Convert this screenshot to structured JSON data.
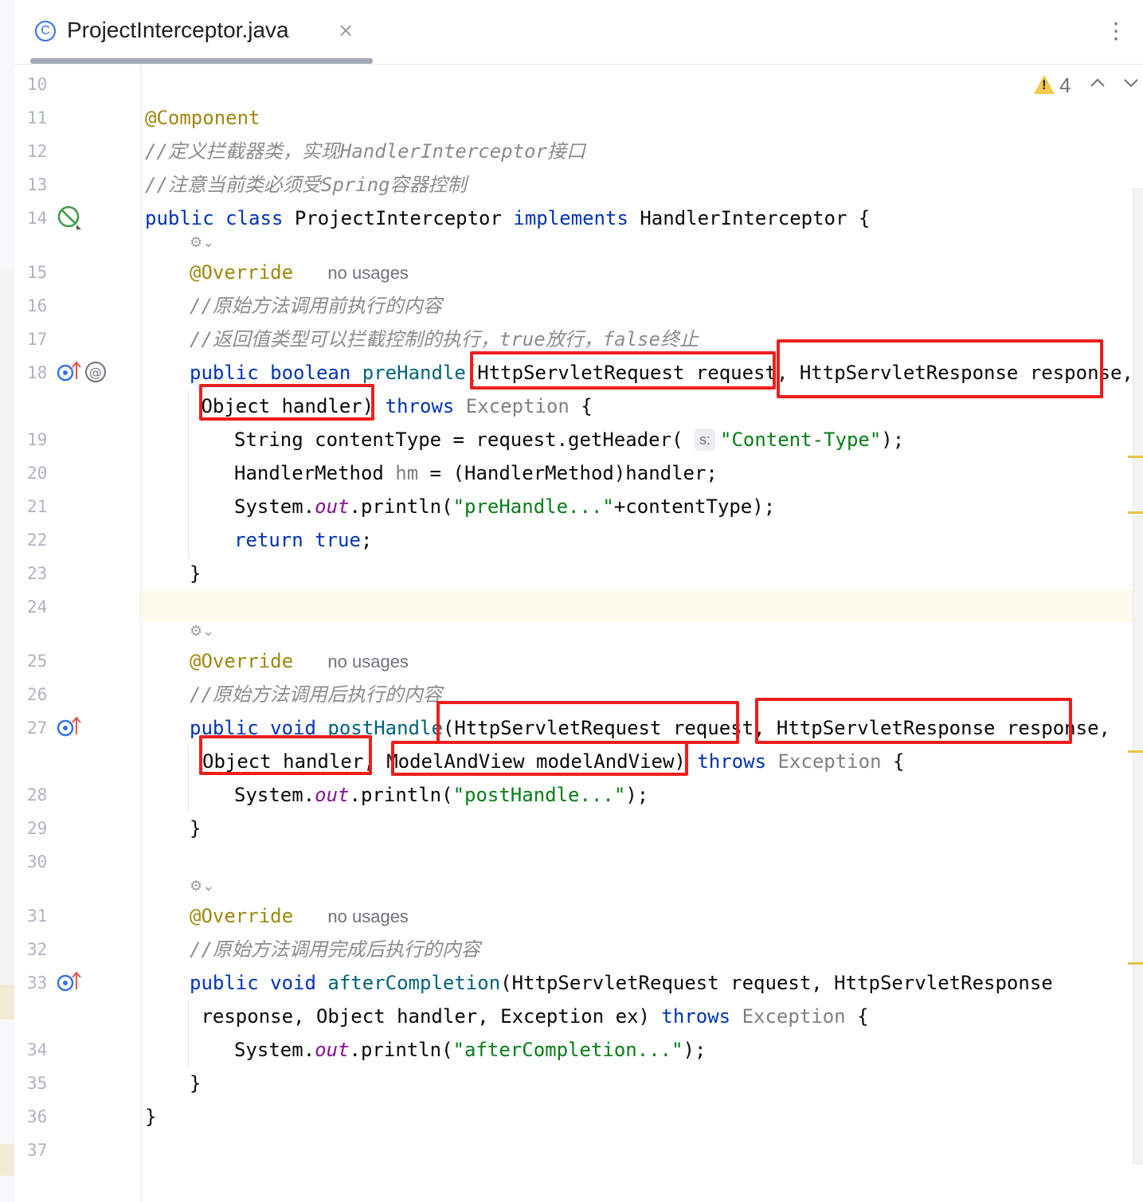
{
  "tab": {
    "title": "ProjectInterceptor.java",
    "icon_letter": "C",
    "close_glyph": "×"
  },
  "toolbar": {
    "more_glyph": "⋮",
    "warning_count": "4",
    "prev_glyph": "⌃",
    "next_glyph": "⌄"
  },
  "colors": {
    "keyword": "#0033b3",
    "annotation": "#9e880d",
    "comment": "#8c8c8c",
    "string": "#067d17",
    "method": "#00627a",
    "static_field": "#871094",
    "highlight_box": "#f01d1d"
  },
  "gutter": {
    "line_numbers": [
      "10",
      "11",
      "12",
      "13",
      "14",
      "15",
      "16",
      "17",
      "18",
      "19",
      "20",
      "21",
      "22",
      "23",
      "24",
      "25",
      "26",
      "27",
      "28",
      "29",
      "30",
      "31",
      "32",
      "33",
      "34",
      "35",
      "36",
      "37"
    ],
    "icons": [
      "no-beans-icon",
      "overrides-method-icon",
      "request-mapping-at-icon",
      "overrides-method-icon",
      "overrides-method-icon"
    ]
  },
  "hints": {
    "no_usages": "no usages",
    "param_hint": "s:"
  },
  "code": {
    "l11": "@Component",
    "l12": "//定义拦截器类，实现HandlerInterceptor接口",
    "l13": "//注意当前类必须受Spring容器控制",
    "l14_public": "public",
    "l14_class": "class",
    "l14_name": "ProjectInterceptor",
    "l14_implements": "implements",
    "l14_iface": "HandlerInterceptor {",
    "override": "@Override",
    "l16": "//原始方法调用前执行的内容",
    "l17": "//返回值类型可以拦截控制的执行，true放行，false终止",
    "l18_public": "public",
    "l18_boolean": "boolean",
    "l18_method": "preHandle",
    "l18_params": "(HttpServletRequest request, HttpServletResponse response,",
    "l18b_params": " Object handler)",
    "throws": "throws",
    "exception_brace_text": "Exception",
    "brace_open": " {",
    "l19_a": "String contentType = request.getHeader(",
    "l19_str": "\"Content-Type\"",
    "l19_end": ");",
    "l20_a": "HandlerMethod ",
    "l20_var": "hm",
    "l20_b": " = (HandlerMethod)handler;",
    "sys": "System.",
    "out": "out",
    "println": ".println(",
    "l21_str": "\"preHandle...\"",
    "l21_end": "+contentType);",
    "l22_return": "return",
    "l22_true": "true",
    "l22_end": ";",
    "brace_close": "}",
    "l26": "//原始方法调用后执行的内容",
    "l27_public": "public",
    "l27_void": "void",
    "l27_method": "postHandle",
    "l27_params": "(HttpServletRequest request, HttpServletResponse response,",
    "l27b_params": "Object handler, ModelAndView modelAndView)",
    "l28_str": "\"postHandle...\"",
    "print_end": ");",
    "l32": "//原始方法调用完成后执行的内容",
    "l33_public": "public",
    "l33_void": "void",
    "l33_method": "afterCompletion",
    "l33_params": "(HttpServletRequest request, HttpServletResponse",
    "l33b_params": " response, Object handler, Exception ex)",
    "l34_str": "\"afterCompletion...\""
  },
  "lens_glyph": "⚙⌄"
}
